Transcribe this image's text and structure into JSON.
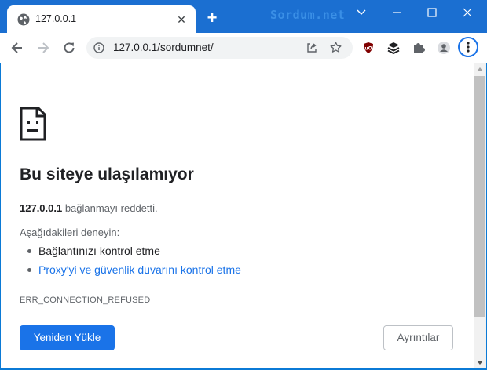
{
  "tab": {
    "title": "127.0.0.1",
    "close_glyph": "✕",
    "new_tab_glyph": "+"
  },
  "watermark": "Sordum.net",
  "window_controls": {
    "minimize": "—",
    "maximize": "☐",
    "close": "✕"
  },
  "toolbar": {
    "url": "127.0.0.1/sordumnet/"
  },
  "extensions": [
    "ublock-origin-icon",
    "stack-icon",
    "puzzle-icon",
    "profile-icon"
  ],
  "page": {
    "heading": "Bu siteye ulaşılamıyor",
    "message_host": "127.0.0.1",
    "message_rest": " bağlanmayı reddetti.",
    "try_label": "Aşağıdakileri deneyin:",
    "suggestions": [
      "Bağlantınızı kontrol etme",
      "Proxy'yi ve güvenlik duvarını kontrol etme"
    ],
    "error_code": "ERR_CONNECTION_REFUSED",
    "reload_label": "Yeniden Yükle",
    "details_label": "Ayrıntılar"
  },
  "colors": {
    "accent": "#1a73e8",
    "titlebar": "#1b6fd1",
    "text": "#202124",
    "muted": "#5f6368"
  }
}
